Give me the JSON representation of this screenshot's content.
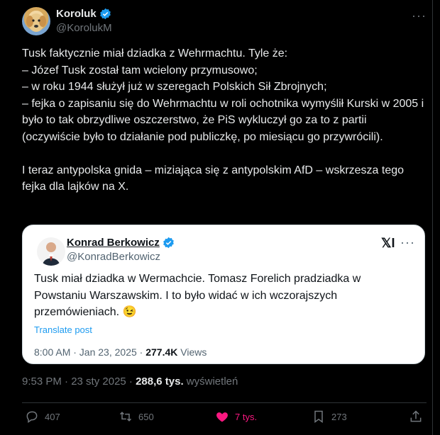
{
  "author": {
    "name": "Koroluk",
    "handle": "@KorolukM"
  },
  "tweet": {
    "text": "Tusk faktycznie miał dziadka z Wehrmachtu. Tyle że:\n– Józef Tusk został tam wcielony przymusowo;\n– w roku 1944 służył już w szeregach Polskich Sił Zbrojnych;\n– fejka o zapisaniu się do Wehrmachtu w roli ochotnika wymyślił Kurski w 2005 i było to tak obrzydliwe oszczerstwo, że PiS wykluczył go za to z partii (oczywiście było to działanie pod publiczkę, po miesiącu go przywrócili).\n\nI teraz antypolska gnida – miziająca się z antypolskim AfD – wskrzesza tego fejka dla lajków na X.",
    "time": "9:53 PM · 23 sty 2025 · ",
    "views": "288,6 tys.",
    "views_label": " wyświetleń"
  },
  "quote": {
    "name": "Konrad Berkowicz",
    "handle": "@KonradBerkowicz",
    "text": "Tusk miał dziadka w Wermachcie. Tomasz Forelich pradziadka w Powstaniu Warszawskim. I to było widać w ich wczorajszych przemówieniach. 😉",
    "translate": "Translate post",
    "time": "8:00 AM · Jan 23, 2025 · ",
    "views": "277.4K",
    "views_label": " Views",
    "logo": "𝕏I"
  },
  "actions": {
    "replies": "407",
    "reposts": "650",
    "likes": "7 tys.",
    "bookmarks": "273"
  },
  "colors": {
    "accent": "#1d9bf0",
    "like": "#f91880"
  }
}
